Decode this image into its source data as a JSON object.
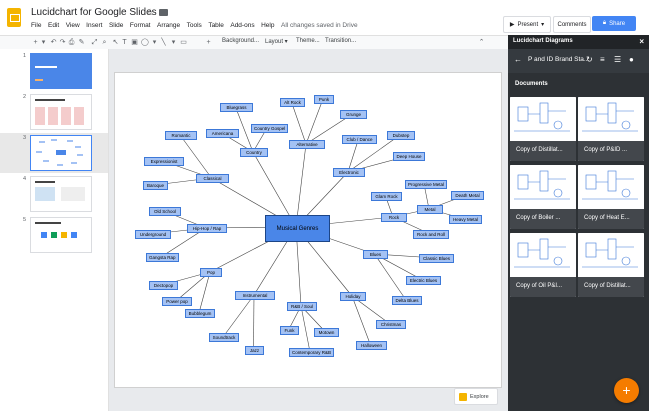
{
  "app": {
    "title": "Lucidchart for Google Slides",
    "star_icon": "star-icon",
    "folder_icon": "folder-icon",
    "menus": [
      "File",
      "Edit",
      "View",
      "Insert",
      "Slide",
      "Format",
      "Arrange",
      "Tools",
      "Table",
      "Add-ons",
      "Help"
    ],
    "save_status": "All changes saved in Drive",
    "present_label": "Present",
    "comments_label": "Comments",
    "share_label": "Share"
  },
  "toolbar": {
    "background_label": "Background...",
    "layout_label": "Layout",
    "theme_label": "Theme...",
    "transition_label": "Transition..."
  },
  "filmstrip": {
    "slides": [
      {
        "num": "1",
        "title": "Lucidchart"
      },
      {
        "num": "2",
        "title": "The Lucidchart Difference"
      },
      {
        "num": "3",
        "title": ""
      },
      {
        "num": "4",
        "title": "Automated Flows"
      },
      {
        "num": "5",
        "title": "Complete Your G Suite"
      }
    ]
  },
  "diagram": {
    "center": "Musical Genres",
    "nodes": [
      {
        "id": "bluegrass",
        "label": "Bluegrass"
      },
      {
        "id": "americana",
        "label": "Americana"
      },
      {
        "id": "country_gospel",
        "label": "Country Gospel"
      },
      {
        "id": "romantic",
        "label": "Romantic"
      },
      {
        "id": "country",
        "label": "Country"
      },
      {
        "id": "alt_rock",
        "label": "Alt Rock"
      },
      {
        "id": "punk",
        "label": "Punk"
      },
      {
        "id": "grunge",
        "label": "Grunge"
      },
      {
        "id": "alternative",
        "label": "Alternative"
      },
      {
        "id": "club_dance",
        "label": "Club / Dance"
      },
      {
        "id": "dubstep",
        "label": "Dubstep"
      },
      {
        "id": "deep_house",
        "label": "Deep House"
      },
      {
        "id": "electronic",
        "label": "Electronic"
      },
      {
        "id": "expressionist",
        "label": "Expressionist"
      },
      {
        "id": "classical",
        "label": "Classical"
      },
      {
        "id": "baroque",
        "label": "Baroque"
      },
      {
        "id": "progressive_metal",
        "label": "Progressive Metal"
      },
      {
        "id": "glam_rock",
        "label": "Glam Rock"
      },
      {
        "id": "death_metal",
        "label": "Death Metal"
      },
      {
        "id": "metal",
        "label": "Metal"
      },
      {
        "id": "heavy_metal",
        "label": "Heavy Metal"
      },
      {
        "id": "rock",
        "label": "Rock"
      },
      {
        "id": "rock_and_roll",
        "label": "Rock and Roll"
      },
      {
        "id": "old_school",
        "label": "Old School"
      },
      {
        "id": "hiphop",
        "label": "Hip-Hop / Rap"
      },
      {
        "id": "underground",
        "label": "Underground"
      },
      {
        "id": "gangsta_rap",
        "label": "Gangsta Rap"
      },
      {
        "id": "blues",
        "label": "Blues"
      },
      {
        "id": "classic_blues",
        "label": "Classic Blues"
      },
      {
        "id": "electric_blues",
        "label": "Electric Blues"
      },
      {
        "id": "delta_blues",
        "label": "Delta Blues"
      },
      {
        "id": "pop",
        "label": "Pop"
      },
      {
        "id": "dectopop",
        "label": "Dectopop"
      },
      {
        "id": "power_pop",
        "label": "Power pop"
      },
      {
        "id": "bubblegum",
        "label": "Bubblegum"
      },
      {
        "id": "instrumental",
        "label": "Instrumental"
      },
      {
        "id": "soundtrack",
        "label": "Soundtrack"
      },
      {
        "id": "jazz",
        "label": "Jazz"
      },
      {
        "id": "rnb_soul",
        "label": "R&B / Soul"
      },
      {
        "id": "funk",
        "label": "Funk"
      },
      {
        "id": "motown",
        "label": "Motown"
      },
      {
        "id": "contemporary_rnb",
        "label": "Contemporary R&B"
      },
      {
        "id": "holiday",
        "label": "Holiday"
      },
      {
        "id": "christmas",
        "label": "Christmas"
      },
      {
        "id": "halloween",
        "label": "Halloween"
      }
    ]
  },
  "explore": {
    "label": "Explore"
  },
  "panel": {
    "header_title": "Lucidchart Diagrams",
    "folder_title": "P and ID Brand Sta...",
    "documents_label": "Documents",
    "cards": [
      {
        "label": "Copy of Distillat..."
      },
      {
        "label": "Copy of P&ID ..."
      },
      {
        "label": "Copy of Boiler ..."
      },
      {
        "label": "Copy of Heat E..."
      },
      {
        "label": "Copy of Oil P&I..."
      },
      {
        "label": "Copy of Distillat..."
      }
    ]
  },
  "colors": {
    "node_fill": "#a4c2f4",
    "node_border": "#3c78d8",
    "center_fill": "#4a86e8",
    "share_blue": "#4285f4",
    "fab_orange": "#f57c00",
    "panel_dark": "#2d3135"
  }
}
